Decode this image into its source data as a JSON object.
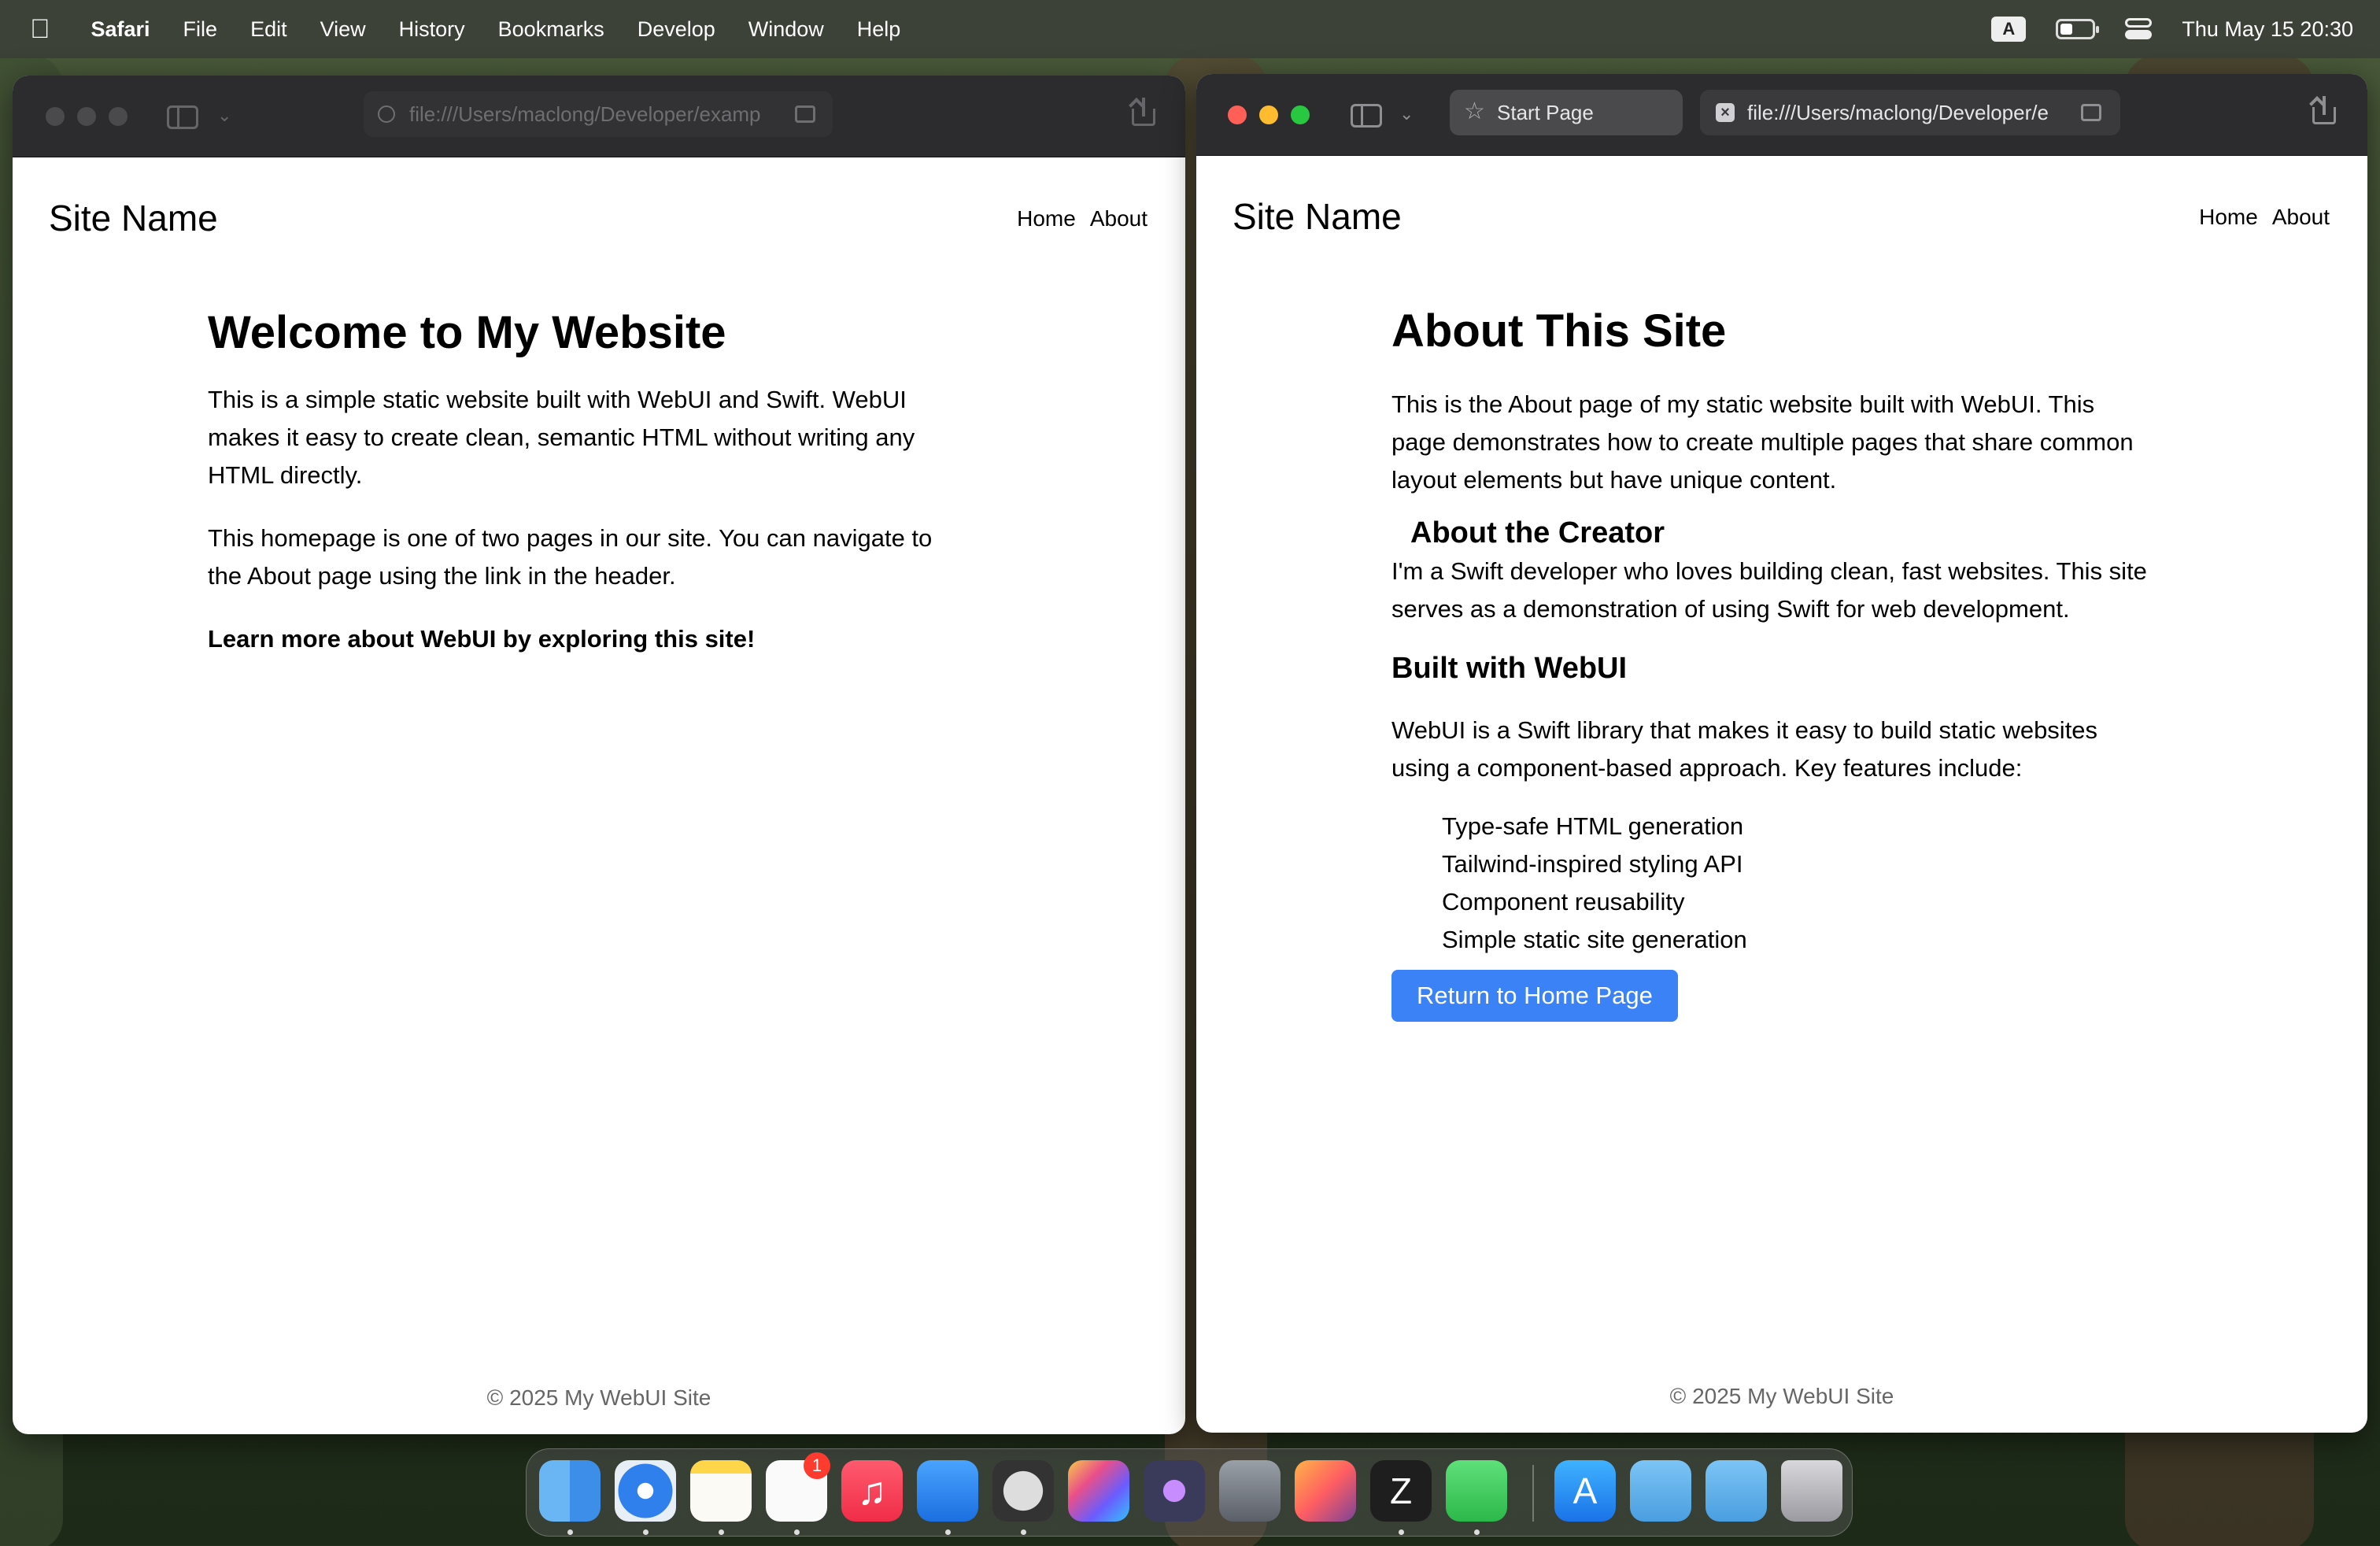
{
  "menubar": {
    "apple": "",
    "app_name": "Safari",
    "items": [
      "File",
      "Edit",
      "View",
      "History",
      "Bookmarks",
      "Develop",
      "Window",
      "Help"
    ],
    "input_source": "A",
    "datetime": "Thu May 15  20:30",
    "battery_level": 0.4
  },
  "left_window": {
    "url": "file:///Users/maclong/Developer/examp",
    "site_name": "Site Name",
    "nav": {
      "home": "Home",
      "about": "About"
    },
    "heading": "Welcome to My Website",
    "paragraph1": "This is a simple static website built with WebUI and Swift. WebUI makes it easy to create clean, semantic HTML without writing any HTML directly.",
    "paragraph2": "This homepage is one of two pages in our site. You can navigate to the About page using the link in the header.",
    "cta": "Learn more about WebUI by exploring this site!",
    "footer": "© 2025 My WebUI Site"
  },
  "right_window": {
    "tab1_label": "Start Page",
    "tab2_url": "file:///Users/maclong/Developer/e",
    "site_name": "Site Name",
    "nav": {
      "home": "Home",
      "about": "About"
    },
    "heading": "About This Site",
    "intro": "This is the About page of my static website built with WebUI. This page demonstrates how to create multiple pages that share common layout elements but have unique content.",
    "creator_heading": "About the Creator",
    "creator_text": "I'm a Swift developer who loves building clean, fast websites. This site serves as a demonstration of using Swift for web development.",
    "built_heading": "Built with WebUI",
    "built_text": "WebUI is a Swift library that makes it easy to build static websites using a component-based approach. Key features include:",
    "features": [
      "Type-safe HTML generation",
      "Tailwind-inspired styling API",
      "Component reusability",
      "Simple static site generation"
    ],
    "button": "Return to Home Page",
    "footer": "© 2025 My WebUI Site"
  },
  "dock": {
    "reminders_badge": "1",
    "apps": [
      "finder-icon",
      "safari-icon",
      "notes-icon",
      "reminders-icon",
      "music-icon",
      "xcode-icon",
      "instruments-icon",
      "final-cut-icon",
      "motion-icon",
      "compressor-icon",
      "pixelmator-icon",
      "zed-icon",
      "facetime-icon",
      "app-store-icon",
      "folder-icon",
      "downloads-folder-icon",
      "trash-icon"
    ]
  },
  "colors": {
    "accent": "#3b82f6",
    "close": "#ff5f57",
    "minimize": "#febc2e",
    "zoom": "#28c840"
  }
}
